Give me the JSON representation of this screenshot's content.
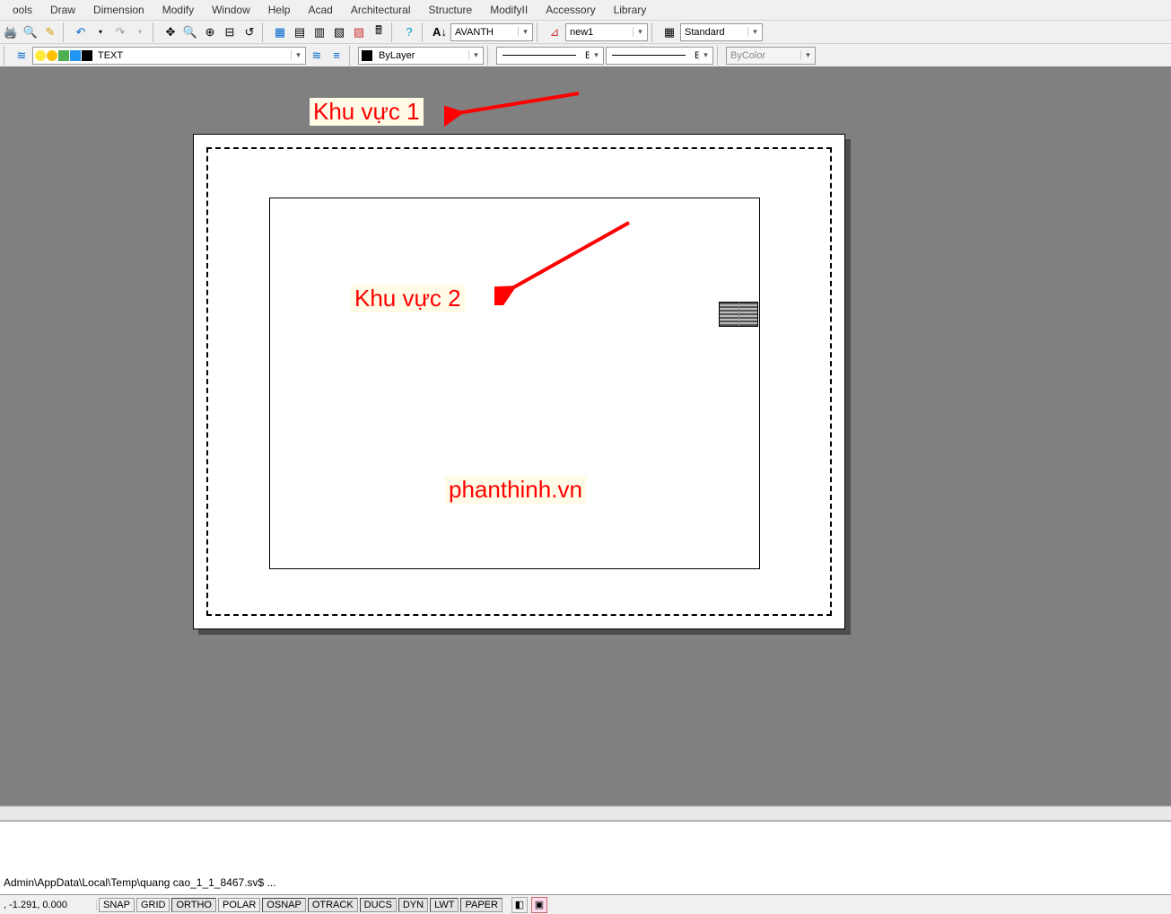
{
  "menu": [
    "ools",
    "Draw",
    "Dimension",
    "Modify",
    "Window",
    "Help",
    "Acad",
    "Architectural",
    "Structure",
    "ModifyII",
    "Accessory",
    "Library"
  ],
  "toolbar1": {
    "text_style": "AVANTH",
    "dim_style": "new1",
    "table_style": "Standard"
  },
  "toolbar2": {
    "layer_name": "TEXT",
    "color": "ByLayer",
    "linetype": "ByLayer",
    "lineweight": "ByLayer",
    "plotstyle": "ByColor"
  },
  "annot": {
    "area1": "Khu vực 1",
    "area2": "Khu vực 2",
    "watermark": "phanthinh.vn"
  },
  "command_line": "Admin\\AppData\\Local\\Temp\\quang cao_1_1_8467.sv$ ...",
  "status": {
    "coords": ", -1.291, 0.000",
    "toggles": [
      "SNAP",
      "GRID",
      "ORTHO",
      "POLAR",
      "OSNAP",
      "OTRACK",
      "DUCS",
      "DYN",
      "LWT",
      "PAPER"
    ]
  }
}
